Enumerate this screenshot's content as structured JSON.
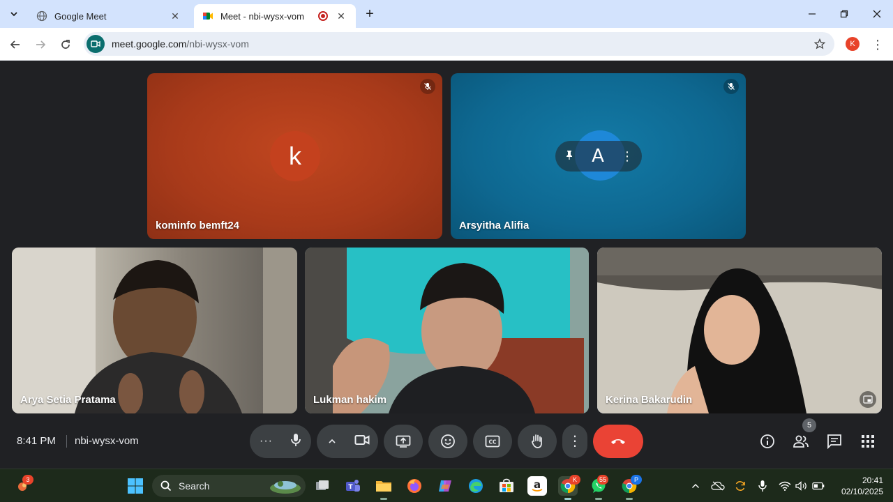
{
  "browser": {
    "tabs": [
      {
        "title": "Google Meet",
        "active": false
      },
      {
        "title": "Meet - nbi-wysx-vom",
        "active": true,
        "recording": true
      }
    ],
    "url": {
      "host": "meet.google.com",
      "path": "/nbi-wysx-vom"
    },
    "profile_initial": "K"
  },
  "meeting": {
    "time": "8:41 PM",
    "code": "nbi-wysx-vom",
    "participant_count": "5",
    "participants": [
      {
        "name": "kominfo bemft24",
        "avatar_letter": "k",
        "muted": true,
        "color": "#b8411f"
      },
      {
        "name": "Arsyitha Alifia",
        "avatar_letter": "A",
        "muted": true,
        "color": "#0f6a94"
      },
      {
        "name": "Arya Setia Pratama",
        "video": true
      },
      {
        "name": "Lukman hakim",
        "video": true
      },
      {
        "name": "Kerina Bakarudin",
        "video": true,
        "selected": true
      }
    ]
  },
  "taskbar": {
    "search_placeholder": "Search",
    "weather_badge": "3",
    "chrome_badge": "K",
    "whatsapp_badge": "55",
    "chrome_profile_badge": "P",
    "clock_time": "20:41",
    "clock_date": "02/10/2025"
  },
  "colors": {
    "meet_bg": "#202124",
    "end_call": "#ea4335",
    "tile_orange": "#b8411f",
    "tile_blue": "#0f6a94"
  }
}
